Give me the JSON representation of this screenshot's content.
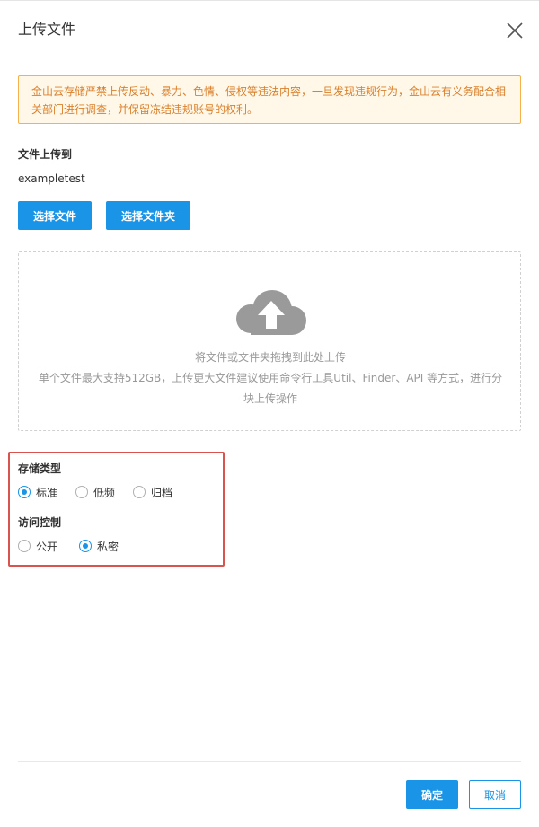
{
  "dialog": {
    "title": "上传文件",
    "close_icon": "close-icon"
  },
  "warning": {
    "text": "金山云存储严禁上传反动、暴力、色情、侵权等违法内容，一旦发现违规行为，金山云有义务配合相关部门进行调查，并保留冻结违规账号的权利。"
  },
  "destination": {
    "label": "文件上传到",
    "bucket": "exampletest"
  },
  "buttons": {
    "select_file": "选择文件",
    "select_folder": "选择文件夹",
    "ok": "确定",
    "cancel": "取消"
  },
  "dropzone": {
    "icon": "cloud-upload-icon",
    "line1": "将文件或文件夹拖拽到此处上传",
    "line2": "单个文件最大支持512GB，上传更大文件建议使用命令行工具Util、Finder、API 等方式，进行分块上传操作"
  },
  "storage_type": {
    "label": "存储类型",
    "options": [
      {
        "label": "标准",
        "checked": true
      },
      {
        "label": "低频",
        "checked": false
      },
      {
        "label": "归档",
        "checked": false
      }
    ]
  },
  "access_control": {
    "label": "访问控制",
    "options": [
      {
        "label": "公开",
        "checked": false
      },
      {
        "label": "私密",
        "checked": true
      }
    ]
  },
  "colors": {
    "primary": "#1a94e6",
    "warning_border": "#f6b24a",
    "warning_bg": "#fff7e8",
    "warning_text": "#d9802b",
    "highlight": "#d9534f"
  }
}
